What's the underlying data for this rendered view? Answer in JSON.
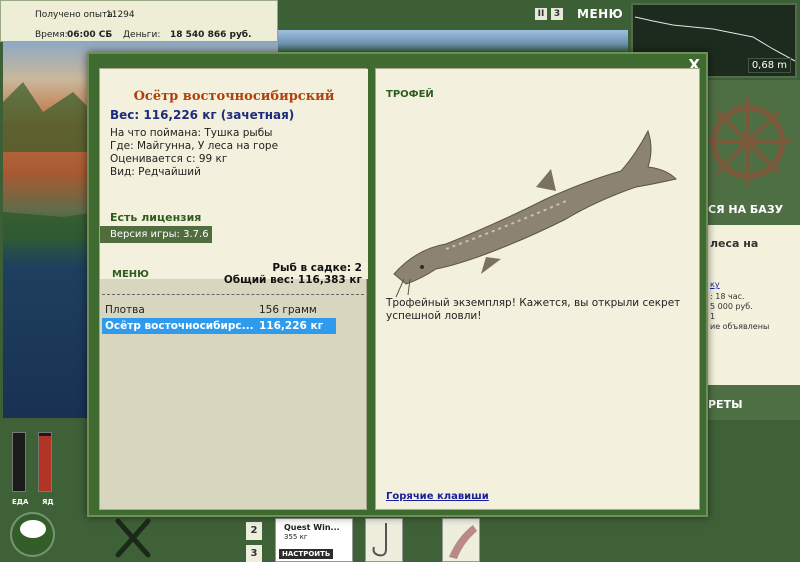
{
  "stats": {
    "experience_label": "Получено опыта:",
    "experience_value": "11294",
    "time_label": "Время:",
    "time_value": "06:00 СБ",
    "money_label": "Деньги:",
    "money_value": "18 540 866 руб."
  },
  "top_bar": {
    "pause_label": "II",
    "speed_label": "3",
    "menu_label": "МЕНЮ",
    "depth_value": "0,68 m"
  },
  "right_panel": {
    "base_text": "СЯ НА БАЗУ",
    "location_text": "леса на",
    "line_1": "ку",
    "line_2": ": 18 час.",
    "line_3": "5 000 руб.",
    "line_4": "1",
    "line_5": "ие объявлены",
    "secrets_text": "РЕТЫ"
  },
  "bottom_bar": {
    "food_label": "ЕДА",
    "poison_label": "ЯД",
    "food_level": 0,
    "poison_level": 0.95,
    "slot_2": "2",
    "slot_3": "3",
    "quest_title": "Quest Win...",
    "quest_weight": "355 кг",
    "quest_button": "НАСТРОИТЬ"
  },
  "modal": {
    "close_label": "X",
    "fish_title": "Осётр восточносибирский",
    "weight": "Вес: 116,226 кг (зачетная)",
    "caught_on": "На что поймана: Тушка рыбы",
    "where": "Где: Майгунна, У леса на горе",
    "valued_from": "Оценивается с: 99 кг",
    "kind": "Вид: Редчайший",
    "license": "Есть лицензия",
    "version_label": "Версия игры:",
    "version_value": "3.7.6",
    "menu_link": "МЕНЮ",
    "fish_in_cage": "Рыб в садке: 2",
    "total_weight": "Общий вес: 116,383 кг",
    "fish_list": [
      {
        "name": "Плотва",
        "weight": "156 грамм"
      },
      {
        "name": "Осётр восточносибирс...",
        "weight": "116,226 кг"
      }
    ],
    "trophy_label": "ТРОФЕЙ",
    "description": "Трофейный экземпляр! Кажется, вы открыли секрет успешной ловли!",
    "hotkeys_link": "Горячие клавиши"
  }
}
